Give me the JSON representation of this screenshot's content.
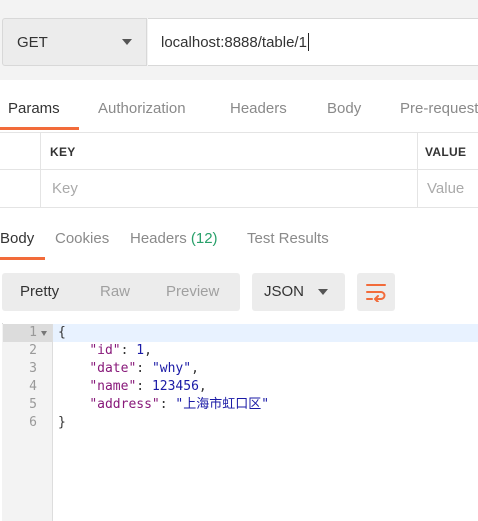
{
  "request": {
    "method": "GET",
    "url": "localhost:8888/table/1"
  },
  "request_tabs": [
    {
      "label": "Params",
      "active": true
    },
    {
      "label": "Authorization",
      "active": false
    },
    {
      "label": "Headers",
      "active": false
    },
    {
      "label": "Body",
      "active": false
    },
    {
      "label": "Pre-request",
      "active": false
    }
  ],
  "params_table": {
    "headers": [
      "KEY",
      "VALUE"
    ],
    "placeholders": {
      "key": "Key",
      "value": "Value"
    }
  },
  "response_tabs": [
    {
      "label": "Body",
      "active": true
    },
    {
      "label": "Cookies",
      "active": false
    },
    {
      "label": "Headers",
      "count": "(12)",
      "active": false
    },
    {
      "label": "Test Results",
      "active": false
    }
  ],
  "view_modes": [
    {
      "label": "Pretty",
      "active": true
    },
    {
      "label": "Raw",
      "active": false
    },
    {
      "label": "Preview",
      "active": false
    }
  ],
  "format": "JSON",
  "icons": {
    "method_dropdown": "chevron-down-icon",
    "format_dropdown": "chevron-down-icon",
    "wrap": "wrap-lines-icon",
    "fold": "fold-arrow-icon"
  },
  "colors": {
    "accent": "#f26b3a",
    "count": "#28a06a",
    "json_key": "#88197a",
    "json_value": "#1a1aa6"
  },
  "response_body": {
    "line_numbers": [
      "1",
      "2",
      "3",
      "4",
      "5",
      "6"
    ],
    "lines": [
      {
        "indent": "",
        "open": "{"
      },
      {
        "indent": "    ",
        "key": "\"id\"",
        "sep": ": ",
        "value": "1",
        "trail": ","
      },
      {
        "indent": "    ",
        "key": "\"date\"",
        "sep": ": ",
        "value": "\"why\"",
        "trail": ","
      },
      {
        "indent": "    ",
        "key": "\"name\"",
        "sep": ": ",
        "value": "123456",
        "trail": ","
      },
      {
        "indent": "    ",
        "key": "\"address\"",
        "sep": ": ",
        "value": "\"上海市虹口区\"",
        "trail": ""
      },
      {
        "indent": "",
        "open": "}"
      }
    ]
  }
}
